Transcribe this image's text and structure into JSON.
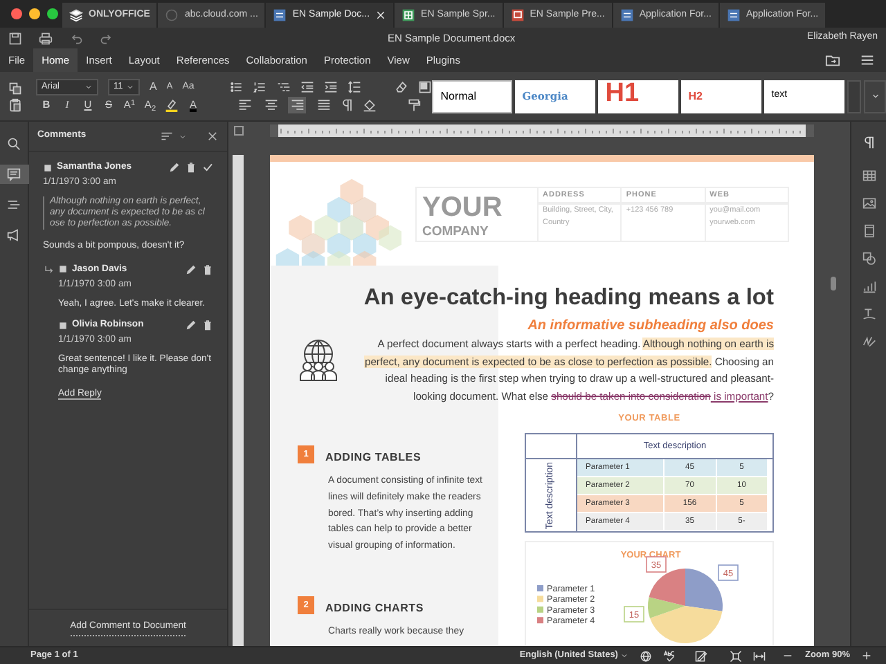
{
  "tabs": [
    {
      "label": "ONLYOFFICE",
      "kind": "app",
      "selected": false
    },
    {
      "label": "abc.cloud.com ...",
      "kind": "portal",
      "selected": false
    },
    {
      "label": "EN Sample Doc...",
      "kind": "document",
      "selected": true
    },
    {
      "label": "EN Sample Spr...",
      "kind": "spreadsheet",
      "selected": false
    },
    {
      "label": "EN Sample Pre...",
      "kind": "presentation",
      "selected": false
    },
    {
      "label": "Application For...",
      "kind": "document",
      "selected": false
    },
    {
      "label": "Application For...",
      "kind": "document",
      "selected": false
    }
  ],
  "window": {
    "title": "EN Sample Document.docx",
    "user": "Elizabeth Rayen"
  },
  "menu": [
    {
      "label": "File",
      "selected": false
    },
    {
      "label": "Home",
      "selected": true
    },
    {
      "label": "Insert",
      "selected": false
    },
    {
      "label": "Layout",
      "selected": false
    },
    {
      "label": "References",
      "selected": false
    },
    {
      "label": "Collaboration",
      "selected": false
    },
    {
      "label": "Protection",
      "selected": false
    },
    {
      "label": "View",
      "selected": false
    },
    {
      "label": "Plugins",
      "selected": false
    }
  ],
  "toolbar": {
    "font": "Arial",
    "size": "11",
    "size_buttons": [
      {
        "label": "A",
        "kind": "grow"
      },
      {
        "label": "A",
        "kind": "shrink"
      },
      {
        "label": "Aa",
        "kind": "case"
      }
    ],
    "format_buttons": [
      {
        "label": "B",
        "kind": "bold"
      },
      {
        "label": "I",
        "kind": "italic"
      },
      {
        "label": "U",
        "kind": "underline"
      },
      {
        "label": "S",
        "kind": "strike"
      },
      {
        "label": "A$^{1}$",
        "kind": "superscript"
      },
      {
        "label": "A$_{2}$",
        "kind": "subscript"
      },
      {
        "label": "A",
        "kind": "color"
      }
    ],
    "alignment": [
      {
        "selected": false
      },
      {
        "selected": false
      },
      {
        "selected": true
      },
      {
        "selected": false
      }
    ],
    "styles": [
      {
        "label": "Normal",
        "kind": "normal",
        "selected": true
      },
      {
        "label": "Georgia",
        "kind": "georgia",
        "selected": false
      },
      {
        "label": "H1",
        "kind": "h1",
        "selected": false
      },
      {
        "label": "H2",
        "kind": "h2",
        "selected": false
      },
      {
        "label": "text",
        "kind": "text",
        "selected": false
      }
    ]
  },
  "left_bar": [
    {
      "selected": false
    },
    {
      "selected": true
    },
    {
      "selected": false
    },
    {
      "selected": false
    }
  ],
  "comments_panel": {
    "title": "Comments",
    "comments": [
      {
        "author": "Samantha Jones",
        "date": "1/1/1970 3:00 am",
        "quote": "Although nothing on earth is perfect, any document is expected to be as close to perfection as possible.",
        "text": "Sounds a bit pompous, doesn't it?",
        "replies": [
          {
            "author": "Jason Davis",
            "date": "1/1/1970 3:00 am",
            "text": "Yeah, I agree. Let's make it clearer."
          },
          {
            "author": "Olivia Robinson",
            "date": "1/1/1970 3:00 am",
            "text": "Great sentence! I like it. Please don't change anything"
          }
        ],
        "add_reply": "Add Reply"
      }
    ],
    "add_comment": "Add Comment to Document"
  },
  "document": {
    "company_name": "YOUR",
    "company_sub": "COMPANY",
    "contacts": [
      {
        "label": "ADDRESS",
        "lines": [
          "Building, Street, City,",
          "Country"
        ]
      },
      {
        "label": "PHONE",
        "lines": [
          "+123 456 789"
        ]
      },
      {
        "label": "WEB",
        "lines": [
          "you@mail.com",
          "yourweb.com"
        ]
      }
    ],
    "heading": "An eye-catch-ing heading means a lot",
    "subheading": "An informative subheading also does",
    "paragraph": [
      {
        "kind": "plain",
        "text": "A perfect document always starts with a perfect heading. "
      },
      {
        "kind": "highlight",
        "text": "Although nothing on earth is perfect, any document is expected to be as close to perfection as possible."
      },
      {
        "kind": "plain",
        "text": " Choosing an ideal heading is the first step when trying to draw up a well-structured and pleasant-looking document. What else "
      },
      {
        "kind": "deleted",
        "text": "should be taken into consideration"
      },
      {
        "kind": "inserted",
        "text": " is important"
      },
      {
        "kind": "plain",
        "text": "?"
      }
    ],
    "sections": [
      {
        "number": "1",
        "title": "ADDING TABLES",
        "text": "A document consisting of infinite text lines will definitely make the readers bored. That’s why inserting adding tables can help to provide a better visual grouping of information."
      },
      {
        "number": "2",
        "title": "ADDING CHARTS",
        "text": "Charts really work because they"
      }
    ],
    "table": {
      "title": "YOUR TABLE",
      "column_header": "Text description",
      "row_header": "Text description",
      "rows": [
        {
          "cells": [
            "Parameter 1",
            "45",
            "5"
          ],
          "color": "#d7e9f0"
        },
        {
          "cells": [
            "Parameter 2",
            "70",
            "10"
          ],
          "color": "#e6efd9"
        },
        {
          "cells": [
            "Parameter 3",
            "156",
            "5"
          ],
          "color": "#f8d8c2"
        },
        {
          "cells": [
            "Parameter 4",
            "35",
            "5-"
          ],
          "color": "#eeeeee"
        }
      ]
    },
    "chart": {
      "chart_data": {
        "type": "pie",
        "title": "YOUR CHART",
        "categories": [
          "Parameter 1",
          "Parameter 2",
          "Parameter 3",
          "Parameter 4"
        ],
        "series": [
          {
            "values": [
              27.3,
              42.4,
              9.1,
              21.2
            ],
            "colors": [
              "#8e9dc8",
              "#f6dc9c",
              "#b9d384",
              "#d98183"
            ]
          }
        ],
        "legend": true,
        "value_labels": [
          "45",
          null,
          "15",
          "35"
        ]
      }
    }
  },
  "status_bar": {
    "page": "Page 1 of 1",
    "language": "English (United States)",
    "zoom": "Zoom 90%"
  }
}
